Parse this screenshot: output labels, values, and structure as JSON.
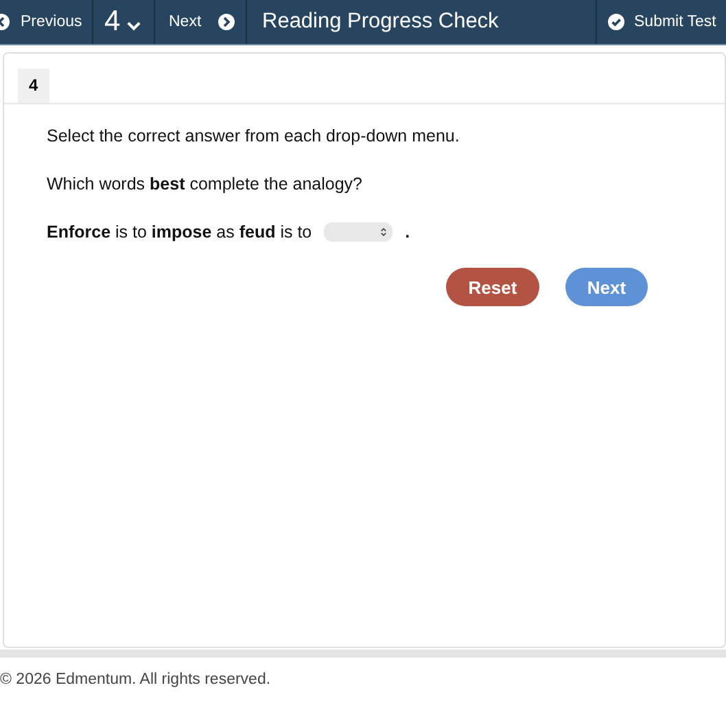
{
  "toolbar": {
    "previous_label": "Previous",
    "question_number": "4",
    "next_label": "Next",
    "title": "Reading Progress Check",
    "submit_label": "Submit Test"
  },
  "question": {
    "tab_label": "4",
    "instruction": "Select the correct answer from each drop-down menu.",
    "prompt": "Which words **best** complete the analogy?",
    "analogy_text": "**Enforce** is to **impose** as **feud** is to",
    "analogy_end": ".",
    "buttons": [
      {
        "kind": "reset",
        "label": "Reset"
      },
      {
        "kind": "next",
        "label": "Next"
      }
    ]
  },
  "footer": "© 2026 Edmentum. All rights reserved."
}
